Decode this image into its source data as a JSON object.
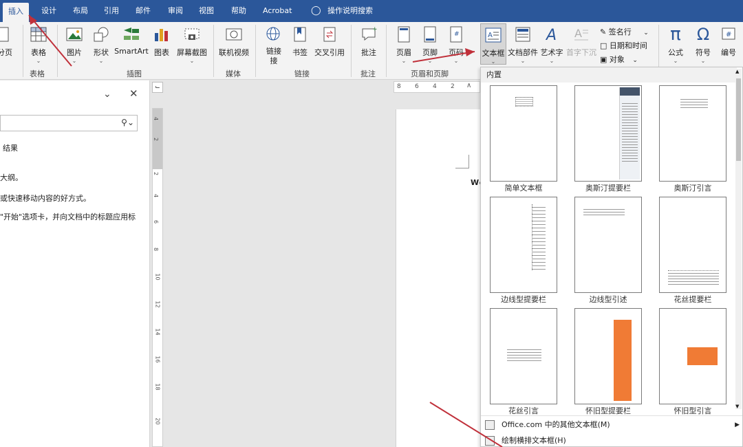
{
  "tabs": [
    "插入",
    "设计",
    "布局",
    "引用",
    "邮件",
    "审阅",
    "视图",
    "帮助",
    "Acrobat"
  ],
  "tell_me": "操作说明搜索",
  "ribbon": {
    "partial_left": "分页",
    "table": "表格",
    "picture": "图片",
    "shapes": "形状",
    "smartart": "SmartArt",
    "chart": "图表",
    "screenshot": "屏幕截图",
    "online_video": "联机视频",
    "link": "链接",
    "link2": "接",
    "bookmark": "书签",
    "cross_ref": "交叉引用",
    "comment": "批注",
    "header": "页眉",
    "footer": "页脚",
    "page_number": "页码",
    "textbox": "文本框",
    "quick_parts": "文档部件",
    "wordart": "艺术字",
    "dropcap": "首字下沉",
    "signature": "签名行",
    "datetime": "日期和时间",
    "object": "对象",
    "equation": "公式",
    "symbol": "符号",
    "number": "编号",
    "groups": {
      "table": "表格",
      "illustrations": "插图",
      "media": "媒体",
      "links": "链接",
      "comments": "批注",
      "header_footer": "页眉和页脚"
    }
  },
  "navpane": {
    "results": "结果",
    "line1": "大纲。",
    "line2": "或快速移动内容的好方式。",
    "line3": "\"开始\"选项卡，并向文档中的标题应用标"
  },
  "hruler_ticks": [
    "8",
    "6",
    "4",
    "2"
  ],
  "vruler_ticks": [
    "4",
    "2",
    "2",
    "4",
    "6",
    "8",
    "10",
    "12",
    "14",
    "16",
    "18",
    "20"
  ],
  "doc_text": "Wo",
  "gallery": {
    "header": "内置",
    "items": [
      "简单文本框",
      "奥斯汀提要栏",
      "奥斯汀引言",
      "边线型提要栏",
      "边线型引述",
      "花丝提要栏",
      "花丝引言",
      "怀旧型提要栏",
      "怀旧型引言"
    ],
    "more": "Office.com 中的其他文本框(M)",
    "draw": "绘制横排文本框(H)"
  },
  "colors": {
    "accent": "#2b579a",
    "annotation": "#c0303a",
    "orange": "#f07b35"
  }
}
